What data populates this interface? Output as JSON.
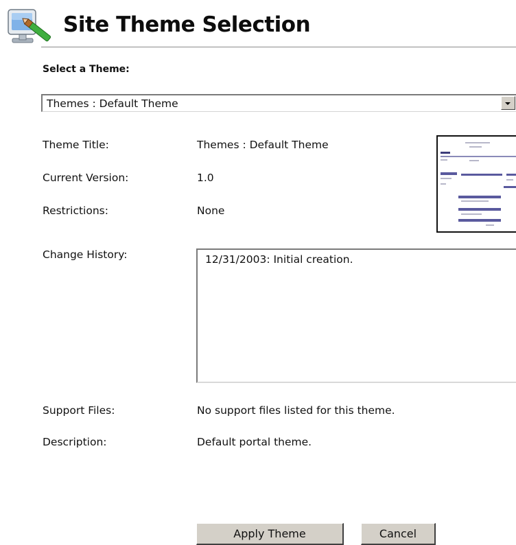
{
  "header": {
    "icon": "theme-settings-icon",
    "title": "Site Theme Selection"
  },
  "select": {
    "label": "Select a Theme:",
    "value": "Themes : Default Theme"
  },
  "details": {
    "title_label": "Theme Title:",
    "title_value": "Themes : Default Theme",
    "version_label": "Current Version:",
    "version_value": "1.0",
    "restrictions_label": "Restrictions:",
    "restrictions_value": "None",
    "history_label": "Change History:",
    "history_value": "12/31/2003: Initial creation.",
    "support_label": "Support Files:",
    "support_value": "No support files listed for this theme.",
    "description_label": "Description:",
    "description_value": "Default portal theme."
  },
  "preview": {
    "icon": "theme-preview-thumbnail",
    "accent": "#5a5a9e"
  },
  "buttons": {
    "apply": "Apply Theme",
    "cancel": "Cancel"
  }
}
